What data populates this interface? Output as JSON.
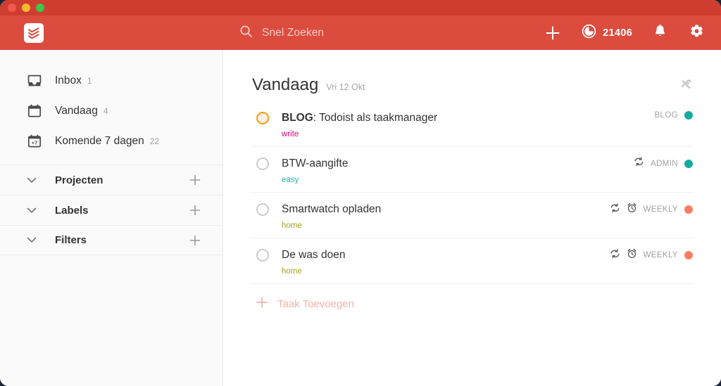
{
  "window": {
    "traffic_lights": [
      "close",
      "minimize",
      "zoom"
    ],
    "titlebar_color": "#cf3c30",
    "toolbar_color": "#db4c3f"
  },
  "toolbar": {
    "logo_name": "todoist-logo",
    "search_placeholder": "Snel Zoeken",
    "add_label": "+",
    "karma_value": "21406",
    "icons": [
      "plus-icon",
      "karma-icon",
      "bell-icon",
      "gear-icon"
    ]
  },
  "sidebar": {
    "items": [
      {
        "label": "Inbox",
        "count": "1",
        "icon": "inbox-icon"
      },
      {
        "label": "Vandaag",
        "count": "4",
        "icon": "calendar-icon"
      },
      {
        "label": "Komende 7 dagen",
        "count": "22",
        "icon": "calendar-7-icon",
        "icon_text": "+7"
      }
    ],
    "sections": [
      {
        "label": "Projecten",
        "chevron": "chevron-down-icon",
        "add": "plus-icon"
      },
      {
        "label": "Labels",
        "chevron": "chevron-down-icon",
        "add": "plus-icon"
      },
      {
        "label": "Filters",
        "chevron": "chevron-down-icon",
        "add": "plus-icon"
      }
    ]
  },
  "main": {
    "title": "Vandaag",
    "subtitle": "Vri 12 Okt",
    "tools_icon": "tools-icon",
    "add_task_label": "Taak Toevoegen",
    "tasks": [
      {
        "title_bold": "BLOG",
        "title_rest": ": Todoist als taakmanager",
        "label": "write",
        "label_color": "#e6007e",
        "priority": "p2",
        "project": "BLOG",
        "project_color": "#14aaa0",
        "recurring": false,
        "reminder": false
      },
      {
        "title_bold": "",
        "title_rest": "BTW-aangifte",
        "label": "easy",
        "label_color": "#25b3b3",
        "priority": "p4",
        "project": "ADMIN",
        "project_color": "#14aaa0",
        "recurring": true,
        "reminder": false
      },
      {
        "title_bold": "",
        "title_rest": "Smartwatch opladen",
        "label": "home",
        "label_color": "#a3a320",
        "priority": "p4",
        "project": "WEEKLY",
        "project_color": "#fc7e62",
        "recurring": true,
        "reminder": true
      },
      {
        "title_bold": "",
        "title_rest": "De was doen",
        "label": "home",
        "label_color": "#a3a320",
        "priority": "p4",
        "project": "WEEKLY",
        "project_color": "#fc7e62",
        "recurring": true,
        "reminder": true
      }
    ]
  }
}
